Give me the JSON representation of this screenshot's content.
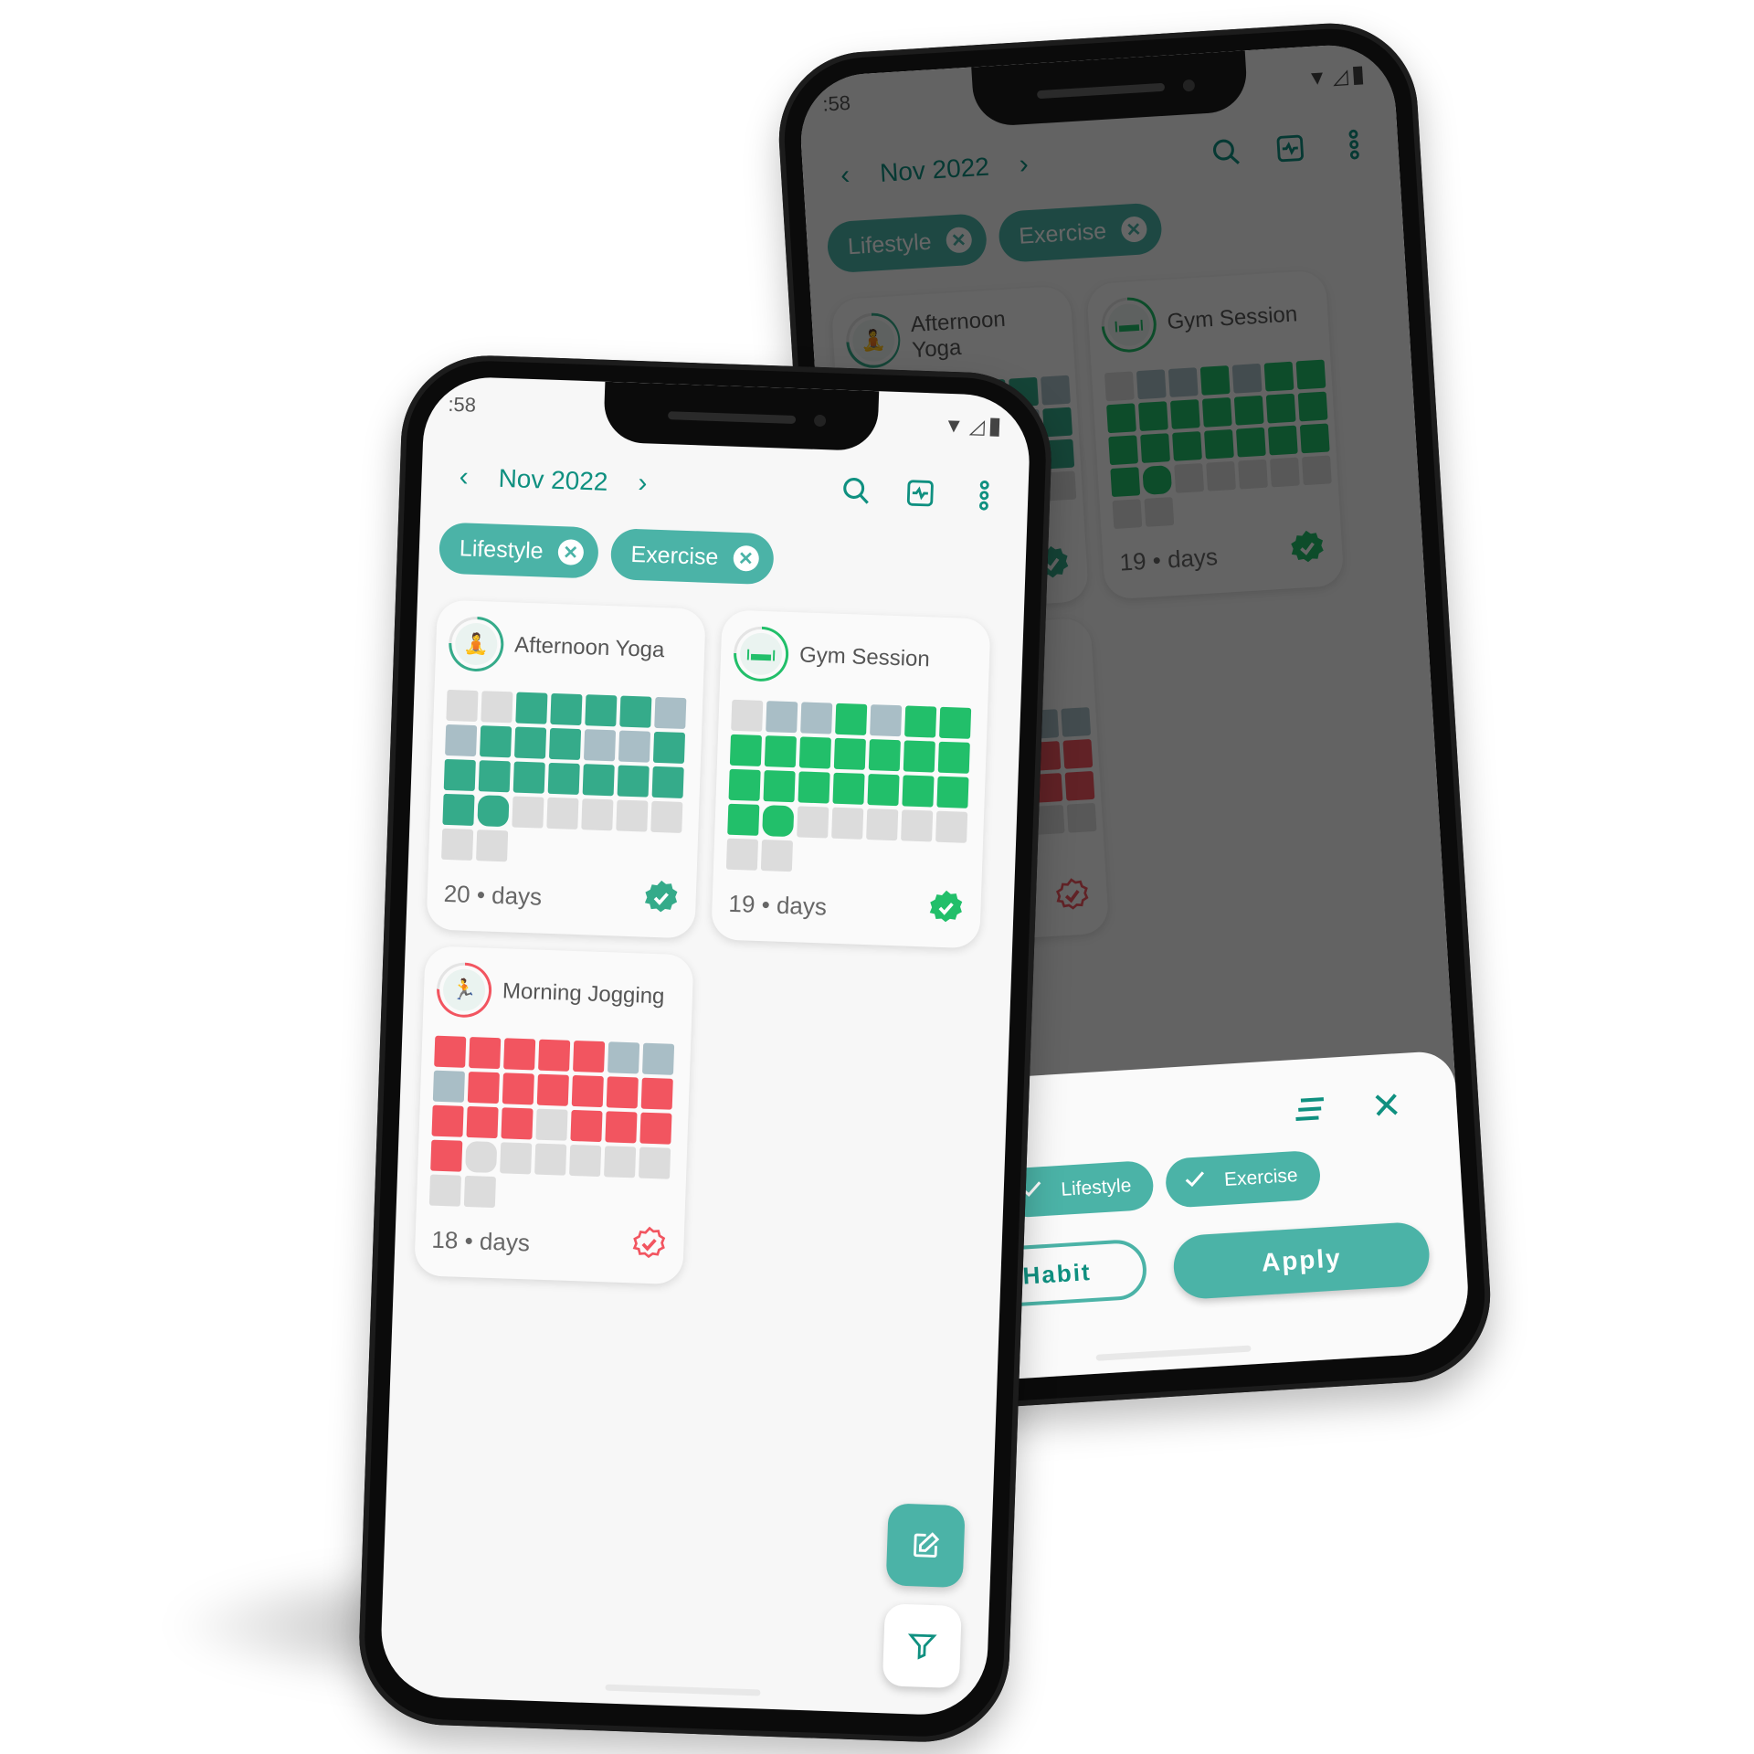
{
  "status": {
    "time": ":58"
  },
  "header": {
    "month": "Nov 2022",
    "prev_icon": "chevron-left-icon",
    "next_icon": "chevron-right-icon",
    "actions": [
      "search-icon",
      "activity-icon",
      "more-vert-icon"
    ]
  },
  "filters": [
    {
      "label": "Lifestyle"
    },
    {
      "label": "Exercise"
    }
  ],
  "colors": {
    "accent": "#0f9080",
    "chip": "#4bb3a7",
    "missed": "#a9bec6",
    "empty": "#dcdcdc"
  },
  "habits": [
    {
      "name": "Afternoon Yoga",
      "count": "20",
      "unit": "days",
      "icon": "yoga-icon",
      "color": "#35ab8a",
      "completed": true,
      "grid": [
        "eeddddm",
        "mdddmmd",
        "ddddddd",
        "dTeeeee",
        "ee"
      ]
    },
    {
      "name": "Gym Session",
      "count": "19",
      "unit": "days",
      "icon": "dumbbell-icon",
      "color": "#22bf6a",
      "completed": true,
      "grid": [
        "emmdmdd",
        "ddddddd",
        "ddddddd",
        "dTeeeee",
        "ee"
      ]
    },
    {
      "name": "Morning Jogging",
      "count": "18",
      "unit": "days",
      "icon": "running-icon",
      "color": "#f25560",
      "completed": false,
      "grid": [
        "dddddmm",
        "mdddddd",
        "dddeddd",
        "dteeeee",
        "ee"
      ]
    }
  ],
  "fabs": [
    {
      "icon": "edit-icon"
    },
    {
      "icon": "filter-icon"
    }
  ],
  "sheet": {
    "sort_icon": "sort-icon",
    "close_icon": "close-icon",
    "chips": [
      {
        "label": "Lifestyle"
      },
      {
        "label": "Exercise"
      }
    ],
    "secondary_button": "Add Habit",
    "apply_button": "Apply"
  }
}
